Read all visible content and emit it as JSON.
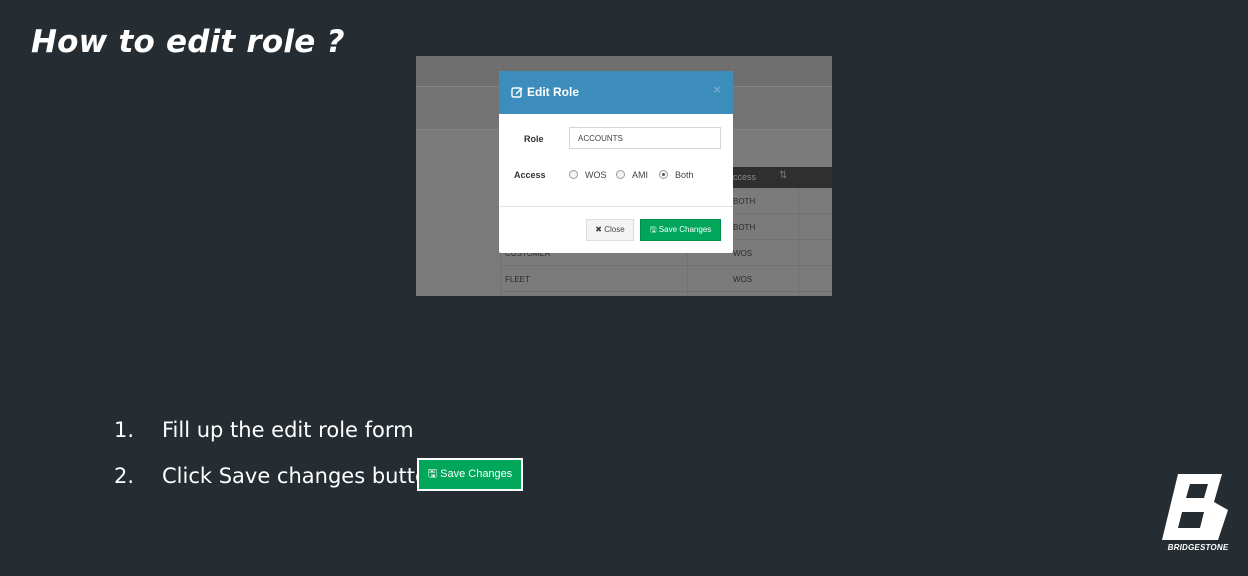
{
  "slide": {
    "title": "How to edit role ?"
  },
  "background_table": {
    "header_access": "ccess",
    "rows": [
      {
        "name": "",
        "access": "BOTH"
      },
      {
        "name": "",
        "access": "BOTH"
      },
      {
        "name": "CUSTOMER",
        "access": "WOS"
      },
      {
        "name": "FLEET",
        "access": "WOS"
      }
    ]
  },
  "modal": {
    "title": "Edit Role",
    "close_symbol": "×",
    "role_label": "Role",
    "role_value": "ACCOUNTS",
    "access_label": "Access",
    "access_options": [
      "WOS",
      "AMI",
      "Both"
    ],
    "access_selected": "Both",
    "close_button": "Close",
    "save_button": "Save Changes"
  },
  "steps": [
    {
      "number": "1.",
      "text": "Fill up the edit role form"
    },
    {
      "number": "2.",
      "text": "Click Save changes button"
    }
  ],
  "save_button_callout": "Save Changes",
  "logo": {
    "text": "BRIDGESTONE"
  },
  "colors": {
    "background": "#252d32",
    "modal_header": "#3c8dbc",
    "save_green": "#00a65a"
  }
}
